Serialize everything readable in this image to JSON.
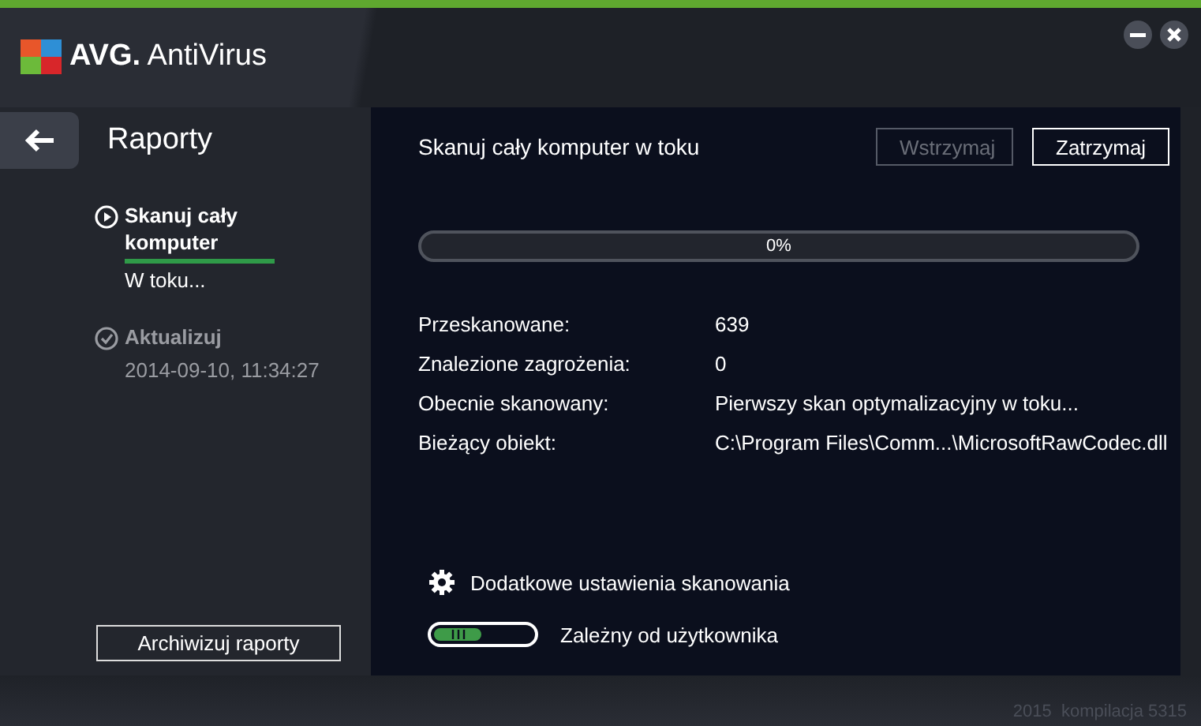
{
  "window": {
    "title": "AVG. AntiVirus"
  },
  "sidebar": {
    "title": "Raporty",
    "items": [
      {
        "kind": "running",
        "label": "Skanuj cały komputer",
        "status": "W toku...",
        "selected": true
      },
      {
        "kind": "done",
        "label": "Aktualizuj",
        "status": "2014-09-10, 11:34:27",
        "selected": false
      }
    ],
    "archive_button": "Archiwizuj raporty"
  },
  "scan": {
    "title": "Skanuj cały komputer w toku",
    "buttons": [
      {
        "label": "Wstrzymaj",
        "disabled": true
      },
      {
        "label": "Zatrzymaj",
        "disabled": false
      }
    ],
    "progress": {
      "level": 0,
      "reading": "0%"
    },
    "details": [
      {
        "label": "Przeskanowane:",
        "value": "639"
      },
      {
        "label": "Znalezione zagrożenia:",
        "value": "0"
      },
      {
        "label": "Obecnie skanowany:",
        "value": "Pierwszy skan optymalizacyjny w toku..."
      },
      {
        "label": "Bieżący obiekt:",
        "value": "C:\\Program Files\\Comm...\\MicrosoftRawCodec.dll"
      }
    ],
    "settings_link": "Dodatkowe ustawienia skanowania",
    "toggle": {
      "label": "Zależny od użytkownika",
      "on": true
    }
  },
  "footer": "2015  kompilacja 5315"
}
